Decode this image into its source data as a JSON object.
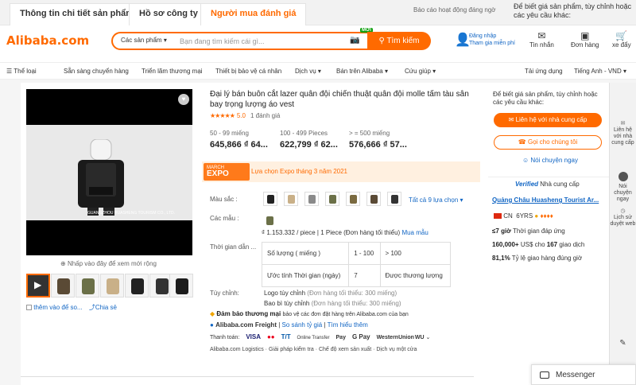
{
  "tabs": [
    "Thông tin chi tiết sản phẩm",
    "Hồ sơ công ty",
    "Người mua đánh giá"
  ],
  "ticker": "Báo cáo hoạt động đáng ngờ",
  "top_info": "Để biết giá sản phẩm, tùy chỉnh hoặc các yêu cầu khác:",
  "logo": "Alibaba.com",
  "search": {
    "category": "Các sản phẩm",
    "placeholder": "Bạn đang tìm kiếm cái gì...",
    "new_badge": "MỚI",
    "button": "Tìm kiếm"
  },
  "account": {
    "signin": "Đăng nhập",
    "join": "Tham gia miễn phí"
  },
  "header_icons": [
    {
      "label": "Tin nhắn",
      "icon": "message-icon"
    },
    {
      "label": "Đơn hàng",
      "icon": "order-icon"
    },
    {
      "label": "xe đẩy",
      "icon": "cart-icon"
    }
  ],
  "nav": {
    "items": [
      "Thể loại",
      "Sẵn sàng chuyển hàng",
      "Triển lãm thương mại",
      "Thiết bị bảo vệ cá nhân",
      "Dịch vụ",
      "Bán trên Alibaba",
      "Cứu giúp"
    ],
    "app": "Tải ứng dụng",
    "lang": "Tiếng Anh - VND"
  },
  "product": {
    "video_caption": "GUANGZHOU HUASHENG TOURISM CO., LTD.",
    "hint": "Nhấp vào đây để xem mới rộng",
    "add_compare": "thêm vào để so...",
    "share": "Chia sẻ",
    "title": "Đại lý bán buôn cắt lazer quân đội chiến thuật quân đội molle tấm tàu sân bay trọng lượng áo vest",
    "stars": "★★★★★",
    "score": "5.0",
    "reviews": "1 đánh giá",
    "prices": [
      {
        "qty": "50 - 99 miếng",
        "price": "645,866 ₫ 64..."
      },
      {
        "qty": "100 - 499 Pieces",
        "price": "622,799 ₫ 62..."
      },
      {
        "qty": "> = 500 miếng",
        "price": "576,666 ₫ 57..."
      }
    ],
    "expo": {
      "logo_top": "MARCH",
      "logo_main": "EXPO",
      "text": "Lựa chọn Expo tháng 3 năm 2021"
    },
    "color_label": "Màu sắc :",
    "color_link": "Tất cả 9 lựa chọn",
    "model_label": "Các mẫu :",
    "model_price": "₫ 1.153.332 / piece | 1 Piece (Đơn hàng tối thiểu)",
    "model_buy": "Mua mẫu",
    "lead_label": "Thời gian dẫn ...",
    "lead_table": [
      [
        "Số lượng ( miếng )",
        "1 - 100",
        "> 100"
      ],
      [
        "Ước tính Thời gian (ngày)",
        "7",
        "Được thương lượng"
      ]
    ],
    "custom_label": "Tùy chỉnh:",
    "custom": [
      {
        "name": "Logo tùy chỉnh",
        "note": "(Đơn hàng tối thiểu: 300 miếng)"
      },
      {
        "name": "Bao bì tùy chỉnh",
        "note": "(Đơn hàng tối thiểu: 300 miếng)"
      }
    ],
    "assurance": "Đảm bảo thương mại",
    "assurance_note": "bảo vệ các đơn đặt hàng trên Alibaba.com của bạn",
    "freight": "Alibaba.com Freight",
    "freight_compare": "So sánh tỷ giá",
    "freight_learn": "Tìm hiểu thêm",
    "pay_label": "Thanh toán:",
    "pay_logos": [
      "VISA",
      "●●",
      "T/T",
      "Online Transfer",
      "Pay",
      "G Pay",
      "WesternUnion",
      "WU"
    ],
    "links": [
      "Alibaba.com Logistics",
      "Giải pháp kiểm tra",
      "Chế độ xem sản xuất",
      "Dịch vụ một cửa"
    ]
  },
  "right": {
    "prompt": "Để biết giá sản phẩm, tùy chỉnh hoặc các yêu cầu khác:",
    "contact": "Liên hệ với nhà cung cấp",
    "call": "Gọi cho chúng tôi",
    "chat": "Nói chuyện ngay",
    "verified": "Verified",
    "verified_suffix": "Nhà cung cấp",
    "supplier": "Quảng Châu Huasheng Tourist Ar...",
    "country": "CN",
    "years": "6YRS",
    "stat1_val": "≤7 giờ",
    "stat1": "Thời gian đáp ứng",
    "stat2_val": "160,000+",
    "stat2_mid": "US$ cho",
    "stat2_num": "167",
    "stat2": "giao dịch",
    "stat3_val": "81,1%",
    "stat3": "Tỷ lệ giao hàng đúng giờ"
  },
  "sidebar": [
    "Liên hệ với nhà cung cấp",
    "Nói chuyện ngay",
    "Lịch sử duyệt web"
  ],
  "messenger": "Messenger",
  "colors": {
    "accent": "#ff6a00",
    "link": "#1266c4"
  }
}
